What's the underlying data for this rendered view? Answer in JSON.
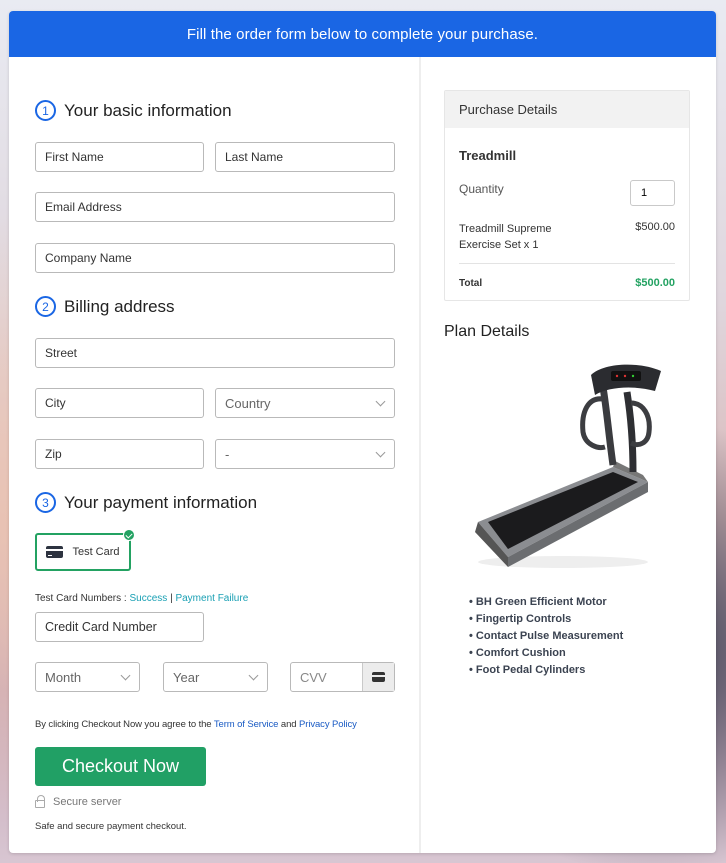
{
  "banner": {
    "text": "Fill the order form below to complete your purchase."
  },
  "sections": {
    "basic": {
      "number": "1",
      "title": "Your basic information"
    },
    "billing": {
      "number": "2",
      "title": "Billing address"
    },
    "payment": {
      "number": "3",
      "title": "Your payment information"
    }
  },
  "basic_fields": {
    "first_name": {
      "placeholder": "First Name",
      "value": ""
    },
    "last_name": {
      "placeholder": "Last Name",
      "value": ""
    },
    "email": {
      "placeholder": "Email Address",
      "value": ""
    },
    "company": {
      "placeholder": "Company Name",
      "value": ""
    }
  },
  "billing_fields": {
    "street": {
      "placeholder": "Street",
      "value": ""
    },
    "city": {
      "placeholder": "City",
      "value": ""
    },
    "country": {
      "selected": "Country"
    },
    "zip": {
      "placeholder": "Zip",
      "value": ""
    },
    "state": {
      "selected": "-"
    }
  },
  "payment": {
    "method_label": "Test Card",
    "method_selected": true,
    "test_numbers_label": "Test Card Numbers :",
    "success_link": "Success",
    "separator": "|",
    "failure_link": "Payment Failure",
    "card_number_placeholder": "Credit Card Number",
    "month_selected": "Month",
    "year_selected": "Year",
    "cvv_placeholder": "CVV"
  },
  "agreement": {
    "prefix": "By clicking Checkout Now you agree to the",
    "terms_link": "Term of Service",
    "and": "and",
    "privacy_link": "Privacy Policy"
  },
  "checkout": {
    "button_label": "Checkout Now",
    "secure_label": "Secure server",
    "safe_note": "Safe and secure payment checkout."
  },
  "purchase_details": {
    "header": "Purchase Details",
    "product_name": "Treadmill",
    "quantity_label": "Quantity",
    "quantity_value": "1",
    "line_item": {
      "name_line1": "Treadmill Supreme",
      "name_line2": "Exercise Set x 1",
      "price": "$500.00"
    },
    "total_label": "Total",
    "total_value": "$500.00",
    "total_color": "#23a262"
  },
  "plan_details": {
    "title": "Plan Details",
    "image_alt": "treadmill",
    "features": [
      "BH Green Efficient Motor",
      "Fingertip Controls",
      "Contact Pulse Measurement",
      "Comfort Cushion",
      "Foot Pedal Cylinders"
    ]
  },
  "colors": {
    "brand_blue": "#1a66e4",
    "success_green": "#21a065",
    "link_teal": "#1aa0b4",
    "link_blue": "#1a5bc4"
  }
}
